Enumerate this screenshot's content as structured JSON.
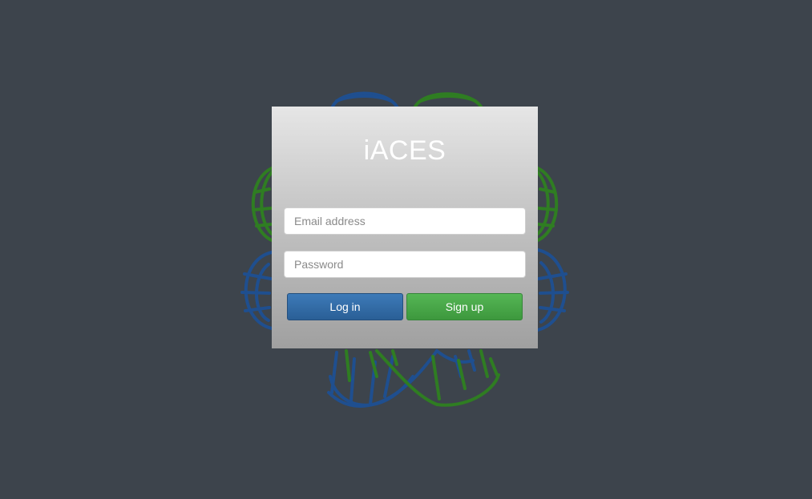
{
  "app": {
    "title": "iACES"
  },
  "form": {
    "email_placeholder": "Email address",
    "password_placeholder": "Password",
    "login_label": "Log in",
    "signup_label": "Sign up"
  },
  "colors": {
    "background": "#3d444c",
    "dna_blue": "#1f4f8f",
    "dna_green": "#2f7d22",
    "login_button": "#2d67a3",
    "signup_button": "#48a848"
  },
  "logo": {
    "icon": "dna-clover-icon"
  }
}
